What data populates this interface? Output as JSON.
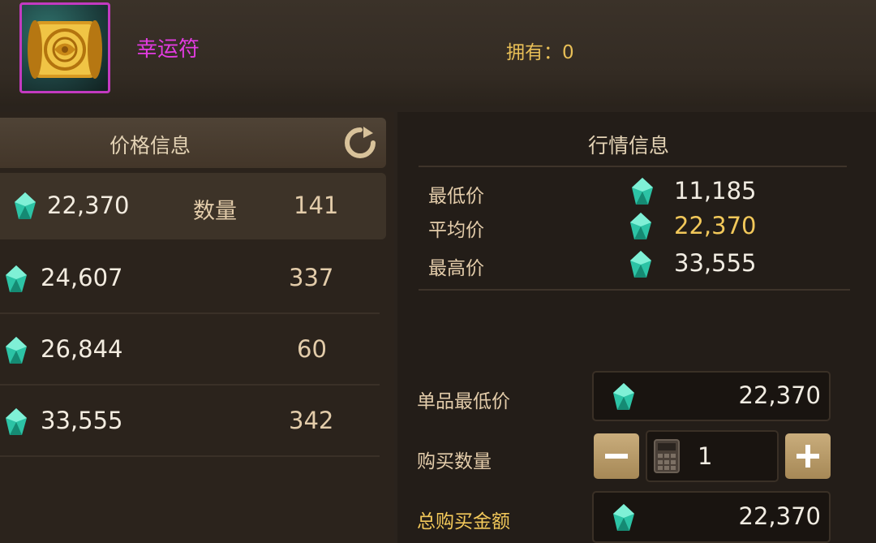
{
  "item": {
    "name": "幸运符",
    "owned_label": "拥有：0"
  },
  "price_panel": {
    "title": "价格信息",
    "quantity_label": "数量",
    "rows": [
      {
        "price": "22,370",
        "qty": "141"
      },
      {
        "price": "24,607",
        "qty": "337"
      },
      {
        "price": "26,844",
        "qty": "60"
      },
      {
        "price": "33,555",
        "qty": "342"
      }
    ]
  },
  "market_panel": {
    "title": "行情信息",
    "stats": [
      {
        "label": "最低价",
        "value": "11,185"
      },
      {
        "label": "平均价",
        "value": "22,370"
      },
      {
        "label": "最高价",
        "value": "33,555"
      }
    ]
  },
  "purchase": {
    "unit_price_label": "单品最低价",
    "unit_price_value": "22,370",
    "qty_label": "购买数量",
    "qty_value": "1",
    "total_label": "总购买金额",
    "total_value": "22,370"
  },
  "colors": {
    "item_name": "#e23be0",
    "gold_text": "#f2c85a",
    "gem": "#2ec4a6"
  },
  "icons": [
    "lucky-charm-scroll-icon",
    "refresh-icon",
    "gem-icon",
    "calculator-icon",
    "minus-icon",
    "plus-icon"
  ]
}
